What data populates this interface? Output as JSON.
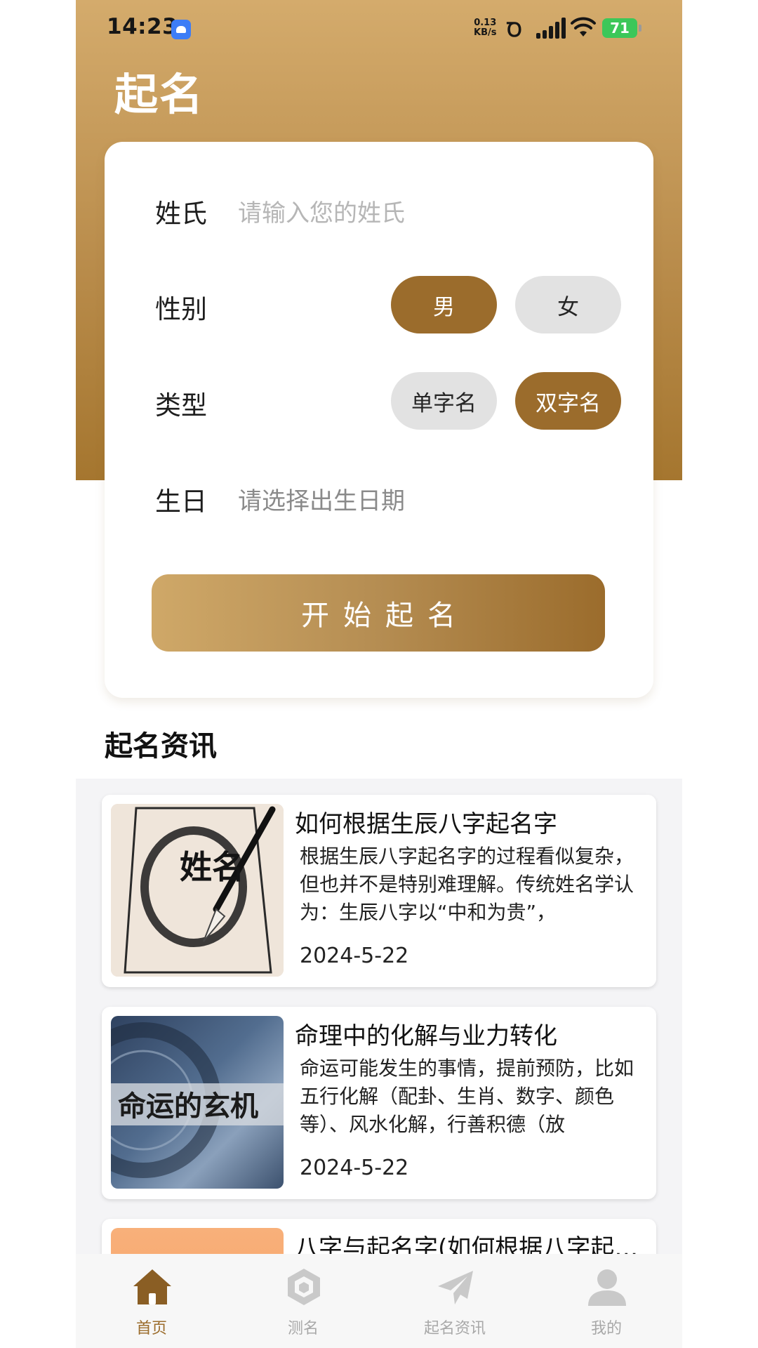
{
  "status": {
    "time": "14:23",
    "net_speed_value": "0.13",
    "net_speed_unit": "KB/s",
    "hd": "Ꝺ",
    "battery": "71"
  },
  "page_title": "起名",
  "form": {
    "surname_label": "姓氏",
    "surname_placeholder": "请输入您的姓氏",
    "gender_label": "性别",
    "gender_options": [
      "男",
      "女"
    ],
    "gender_selected": "男",
    "type_label": "类型",
    "type_options": [
      "单字名",
      "双字名"
    ],
    "type_selected": "双字名",
    "birthday_label": "生日",
    "birthday_placeholder": "请选择出生日期",
    "submit_label": "开始起名"
  },
  "news_section_title": "起名资讯",
  "news": [
    {
      "title": "如何根据生辰八字起名字",
      "desc": "根据生辰八字起名字的过程看似复杂，但也并不是特别难理解。传统姓名学认为：生辰八字以“中和为贵”，",
      "date": "2024-5-22",
      "thumb_text": "姓名"
    },
    {
      "title": "命理中的化解与业力转化",
      "desc": "命运可能发生的事情，提前预防，比如五行化解（配卦、生肖、数字、颜色等）、风水化解，行善积德（放",
      "date": "2024-5-22",
      "thumb_text": "命运的玄机"
    },
    {
      "title": "八字与起名字(如何根据八字起名字)",
      "desc": "",
      "date": ""
    }
  ],
  "tabs": [
    {
      "label": "首页",
      "icon": "home-icon",
      "active": true
    },
    {
      "label": "测名",
      "icon": "test-name-icon",
      "active": false
    },
    {
      "label": "起名资讯",
      "icon": "paper-plane-icon",
      "active": false
    },
    {
      "label": "我的",
      "icon": "user-icon",
      "active": false
    }
  ],
  "colors": {
    "accent": "#9b6c2c",
    "hero_top": "#d4ab6c",
    "hero_bottom": "#a5762f",
    "pill_inactive": "#e2e2e2",
    "battery": "#3cc759"
  }
}
